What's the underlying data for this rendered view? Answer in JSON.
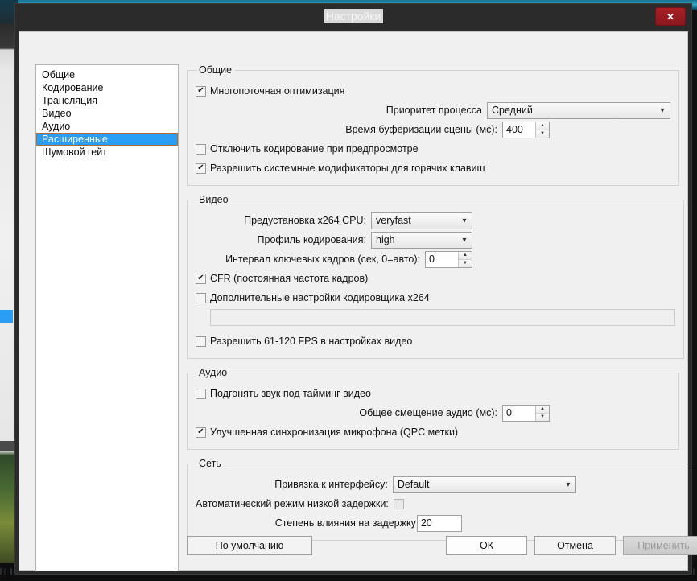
{
  "window": {
    "title": "Настройки",
    "close_label": "✕",
    "close_icon": "close-icon"
  },
  "sidebar": {
    "items": [
      {
        "label": "Общие",
        "selected": false
      },
      {
        "label": "Кодирование",
        "selected": false
      },
      {
        "label": "Трансляция",
        "selected": false
      },
      {
        "label": "Видео",
        "selected": false
      },
      {
        "label": "Аудио",
        "selected": false
      },
      {
        "label": "Расширенные",
        "selected": true
      },
      {
        "label": "Шумовой гейт",
        "selected": false
      }
    ]
  },
  "groups": {
    "general": {
      "legend": "Общие",
      "multithreaded_label": "Многопоточная оптимизация",
      "multithreaded_checked": true,
      "priority_label": "Приоритет процесса",
      "priority_value": "Средний",
      "scene_buffer_label": "Время буферизации сцены (мс):",
      "scene_buffer_value": "400",
      "disable_preview_label": "Отключить кодирование при предпросмотре",
      "disable_preview_checked": false,
      "system_hotkeys_label": "Разрешить системные модификаторы для горячих клавиш",
      "system_hotkeys_checked": true
    },
    "video": {
      "legend": "Видео",
      "x264_preset_label": "Предустановка x264 CPU:",
      "x264_preset_value": "veryfast",
      "profile_label": "Профиль кодирования:",
      "profile_value": "high",
      "keyframe_label": "Интервал ключевых кадров (сек, 0=авто):",
      "keyframe_value": "0",
      "cfr_label": "CFR (постоянная частота кадров)",
      "cfr_checked": true,
      "custom_x264_label": "Дополнительные настройки кодировщика x264",
      "custom_x264_checked": false,
      "custom_x264_value": "",
      "custom_x264_placeholder": "",
      "high_fps_label": "Разрешить 61-120 FPS в настройках видео",
      "high_fps_checked": false
    },
    "audio": {
      "legend": "Аудио",
      "sync_to_video_label": "Подгонять звук под тайминг видео",
      "sync_to_video_checked": false,
      "offset_label": "Общее смещение аудио (мс):",
      "offset_value": "0",
      "mic_qpc_label": "Улучшенная синхронизация микрофона (QPC метки)",
      "mic_qpc_checked": true
    },
    "network": {
      "legend": "Сеть",
      "bind_label": "Привязка к интерфейсу:",
      "bind_value": "Default",
      "low_latency_label": "Автоматический режим низкой задержки:",
      "low_latency_checked": false,
      "latency_factor_label": "Степень влияния на задержку",
      "latency_factor_value": "20"
    }
  },
  "footer": {
    "defaults_label": "По умолчанию",
    "ok_label": "ОК",
    "cancel_label": "Отмена",
    "apply_label": "Применить",
    "apply_enabled": false
  },
  "colors": {
    "accent_selection": "#2a9df4",
    "window_chrome": "#2b2b2b",
    "dialog_bg": "#f0f0f0",
    "close_red": "#a52025"
  },
  "icons": {
    "spin_up": "▲",
    "spin_down": "▼",
    "combo_arrow": "⌄",
    "check": "✔"
  }
}
